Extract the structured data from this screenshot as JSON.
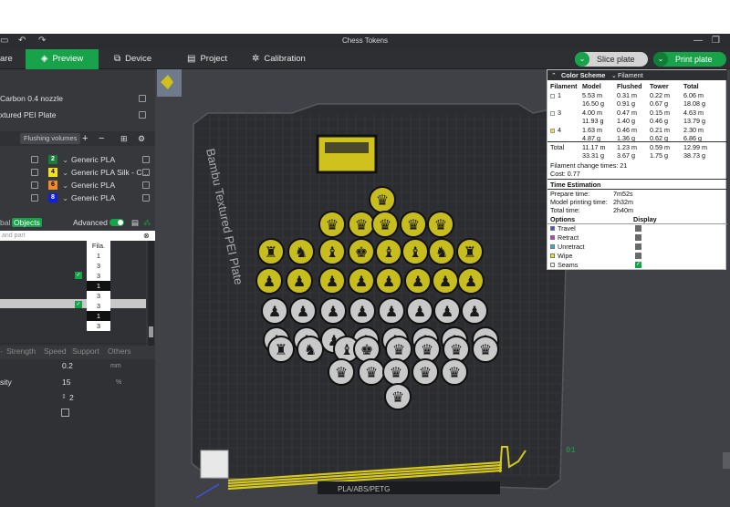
{
  "window": {
    "title": "Chess Tokens"
  },
  "tabs": {
    "prepare": "are",
    "preview": "Preview",
    "device": "Device",
    "project": "Project",
    "calibration": "Calibration"
  },
  "actions": {
    "slice": "Slice plate",
    "print": "Print plate"
  },
  "left": {
    "nozzle": "Carbon 0.4 nozzle",
    "plate": "xtured PEI Plate",
    "flushing": "Flushing volumes",
    "filaments": [
      {
        "num": "2",
        "name": "Generic PLA",
        "color": "#1a7a3a",
        "text": "#ffffff"
      },
      {
        "num": "4",
        "name": "Generic PLA Silk - C...",
        "color": "#f2e21a",
        "text": "#000000"
      },
      {
        "num": "6",
        "name": "Generic PLA",
        "color": "#f08a2a",
        "text": "#000000"
      },
      {
        "num": "8",
        "name": "Generic PLA",
        "color": "#1020d8",
        "text": "#ffffff"
      }
    ],
    "objects_tab1": "bal",
    "objects_tab2": "Objects",
    "advanced": "Advanced",
    "search_placeholder": "and part",
    "fila_header": "Fila.",
    "fila_values": [
      "1",
      "3",
      "3",
      "1",
      "3",
      "3",
      "1",
      "3"
    ],
    "param_tabs": [
      "Strength",
      "Speed",
      "Support",
      "Others"
    ],
    "params": {
      "layer": "0.2",
      "layer_unit": "mm",
      "density_label": "sity",
      "density": "15",
      "density_unit": "%",
      "walls": "2"
    }
  },
  "viewport": {
    "plate_text": "Bambu Textured PEI Plate",
    "plate_label": "PLA/ABS/PETG",
    "axis_label": "01"
  },
  "legend": {
    "title": "Color Scheme",
    "scheme": "Filament",
    "cols": [
      "Filament",
      "Model",
      "Flushed",
      "Tower",
      "Total"
    ],
    "rows": [
      {
        "id": "1",
        "color": "#ffffff",
        "model": [
          "5.53 m",
          "16.50 g"
        ],
        "flushed": [
          "0.31 m",
          "0.91 g"
        ],
        "tower": [
          "0.22 m",
          "0.67 g"
        ],
        "total": [
          "6.06 m",
          "18.08 g"
        ]
      },
      {
        "id": "3",
        "color": "#ffffff",
        "model": [
          "4.00 m",
          "11.93 g"
        ],
        "flushed": [
          "0.47 m",
          "1.40 g"
        ],
        "tower": [
          "0.15 m",
          "0.46 g"
        ],
        "total": [
          "4.63 m",
          "13.79 g"
        ]
      },
      {
        "id": "4",
        "color": "#f2e21a",
        "model": [
          "1.63 m",
          "4.87 g"
        ],
        "flushed": [
          "0.46 m",
          "1.36 g"
        ],
        "tower": [
          "0.21 m",
          "0.62 g"
        ],
        "total": [
          "2.30 m",
          "6.86 g"
        ]
      }
    ],
    "total": {
      "label": "Total",
      "model": [
        "11.17 m",
        "33.31 g"
      ],
      "flushed": [
        "1.23 m",
        "3.67 g"
      ],
      "tower": [
        "0.59 m",
        "1.75 g"
      ],
      "total": [
        "12.99 m",
        "38.73 g"
      ]
    },
    "change_times": "Filament change times: 21",
    "cost": "Cost: 0.77",
    "time_title": "Time Estimation",
    "prepare_label": "Prepare time:",
    "prepare": "7m52s",
    "model_label": "Model printing time:",
    "model_time": "2h32m",
    "total_label": "Total time:",
    "total_time": "2h40m",
    "options_title": "Options",
    "display_title": "Display",
    "options": [
      {
        "name": "Travel",
        "color": "#3a56d8",
        "checked": false
      },
      {
        "name": "Retract",
        "color": "#d030c8",
        "checked": false
      },
      {
        "name": "Unretract",
        "color": "#20b8c8",
        "checked": false
      },
      {
        "name": "Wipe",
        "color": "#f2e21a",
        "checked": false
      },
      {
        "name": "Seams",
        "color": "#f0f0f0",
        "checked": true
      }
    ]
  }
}
